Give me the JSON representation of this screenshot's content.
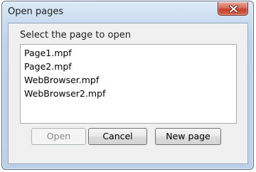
{
  "window": {
    "title": "Open pages"
  },
  "dialog": {
    "prompt": "Select the page to open",
    "pages": [
      "Page1.mpf",
      "Page2.mpf",
      "WebBrowser.mpf",
      "WebBrowser2.mpf"
    ]
  },
  "buttons": {
    "open_label": "Open",
    "cancel_label": "Cancel",
    "new_page_label": "New page"
  },
  "icons": {
    "close": "close-x-icon"
  },
  "colors": {
    "frame": "#c9dcf0",
    "close_button": "#c7412c",
    "client": "#f0f0f0"
  }
}
